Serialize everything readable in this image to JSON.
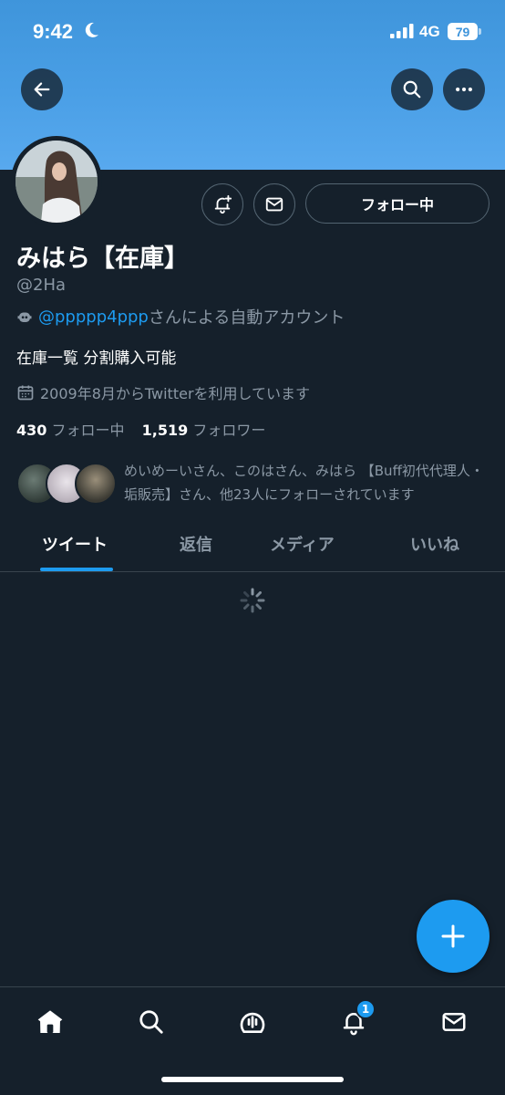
{
  "status": {
    "time": "9:42",
    "network": "4G",
    "battery": "79"
  },
  "profile": {
    "name": "みはら【在庫】",
    "handle": "@2Ha",
    "automated_link": "@ppppp4ppp",
    "automated_text": "さんによる自動アカウント",
    "bio": "在庫一覧 分割購入可能",
    "joined": "2009年8月からTwitterを利用しています",
    "following_count": "430",
    "following_label": "フォロー中",
    "followers_count": "1,519",
    "followers_label": "フォロワー",
    "followed_by": "めいめーいさん、このはさん、みはら 【Buff初代代理人・垢販売】さん、他23人にフォローされています"
  },
  "actions": {
    "follow_label": "フォロー中"
  },
  "tabs": [
    {
      "label": "ツイート",
      "active": true
    },
    {
      "label": "返信",
      "active": false
    },
    {
      "label": "メディア",
      "active": false
    },
    {
      "label": "いいね",
      "active": false
    }
  ],
  "bottom_nav": {
    "items": [
      "home-icon",
      "search-icon",
      "spaces-icon",
      "notifications-icon",
      "messages-icon"
    ],
    "notification_badge": "1"
  },
  "colors": {
    "accent": "#1d9bf0",
    "background": "#15202b",
    "banner": "#4a9fe6",
    "muted": "#8b98a5"
  }
}
